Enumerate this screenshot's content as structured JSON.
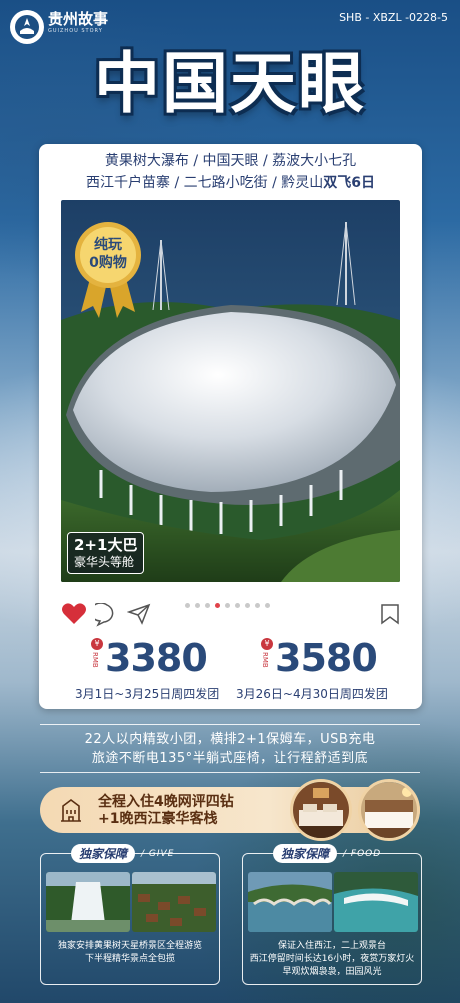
{
  "brand": {
    "name_cn": "贵州故事",
    "name_en": "GUIZHOU STORY"
  },
  "code": "SHB - XBZL -0228-5",
  "title": "中国天眼",
  "route": {
    "line1": "黄果树大瀑布 / 中国天眼 / 荔波大小七孔",
    "line2_prefix": "西江千户苗寨 / 二七路小吃街 / 黔灵山",
    "line2_bold": "双飞6日"
  },
  "badge": {
    "line1": "纯玩",
    "line2": "0购物"
  },
  "bus": {
    "main": "2+1大巴",
    "sub": "豪华头等舱"
  },
  "carousel": {
    "count": 9,
    "active": 3
  },
  "prices": [
    {
      "currency": "RMB",
      "symbol": "¥",
      "amount": "3380",
      "dates": "3月1日~3月25日周四发团"
    },
    {
      "currency": "RMB",
      "symbol": "¥",
      "amount": "3580",
      "dates": "3月26日~4月30日周四发团"
    }
  ],
  "features": {
    "line1": "22人以内精致小团，横排2+1保姆车，USB充电",
    "line2": "旅途不断电135°半躺式座椅，让行程舒适到底"
  },
  "hotel": {
    "line1": "全程入住4晚网评四钻",
    "line2": "+1晚西江豪华客栈"
  },
  "sections": [
    {
      "tag": "独家保障",
      "en": "/ GIVE",
      "note": "独家安排黄果树天星桥景区全程游览\n下半程精华景点全包揽"
    },
    {
      "tag": "独家保障",
      "en": "/ FOOD",
      "note": "保证入住西江，二上观景台\n西江停留时间长达16小时，夜赏万家灯火\n早观炊烟袅袅，田园风光"
    }
  ],
  "colors": {
    "accent": "#e0434a",
    "navy": "#2a4a7a",
    "gold": "#f0c35a"
  }
}
